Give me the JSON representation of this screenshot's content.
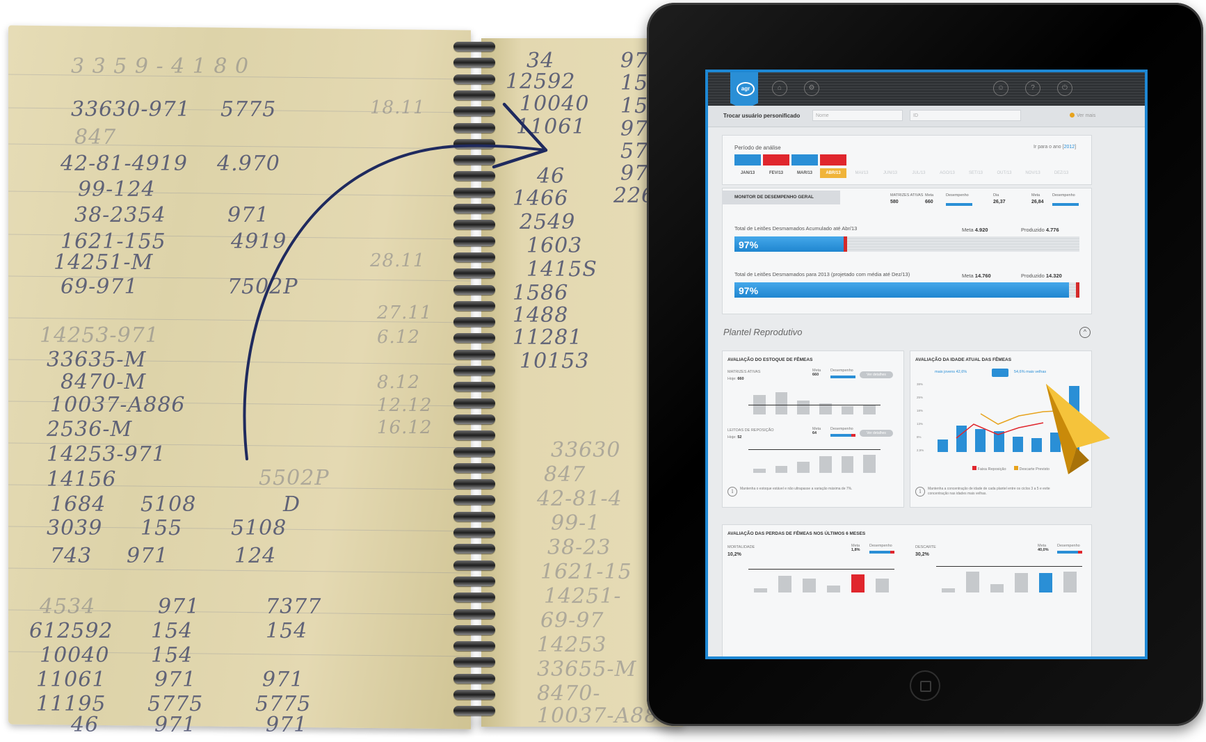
{
  "notebook": {
    "left_lines": [
      "33630-971",
      "5775",
      "42-81-4919",
      "4.970",
      "99-124",
      "38-2354",
      "971",
      "1621-155",
      "4919",
      "14251-M",
      "69-971",
      "7502P",
      "14253-971",
      "33635-M",
      "8470-M",
      "10037-A886",
      "2536-M",
      "14253-971",
      "14156",
      "1684",
      "5108",
      "155",
      "D",
      "3039",
      "155",
      "5108",
      "743",
      "971",
      "124",
      "4534",
      "971",
      "7377",
      "612592",
      "154",
      "154",
      "10040",
      "154",
      "11061",
      "971",
      "971",
      "11195",
      "5775",
      "5775",
      "46",
      "971",
      "971",
      "5502P",
      "28.11",
      "27.11",
      "6.12",
      "8.12",
      "12.12",
      "16.12"
    ],
    "right_lines": [
      "34",
      "12592",
      "10040",
      "11061",
      "46",
      "1466",
      "2549",
      "1603",
      "1415S",
      "1586",
      "1488",
      "11281",
      "10153",
      "971",
      "154",
      "154",
      "971",
      "572",
      "971",
      "226",
      "33630",
      "847",
      "42-81-4",
      "99-1",
      "38-23",
      "1621-15",
      "14251-",
      "69-97",
      "14253",
      "33655-M",
      "8470-",
      "10037-A886"
    ]
  },
  "app": {
    "logo_text": "agr",
    "user_bar": {
      "label": "Trocar usuário personificado",
      "field1_placeholder": "Nome",
      "field2_placeholder": "ID",
      "badge": "Ver mais"
    },
    "period": {
      "title": "Período de análise",
      "year_label": "Ir para o ano",
      "year": "2012",
      "months": [
        "JAN/13",
        "FEV/13",
        "MAR/13",
        "ABR/13",
        "MAI/13",
        "JUN/13",
        "JUL/13",
        "AGO/13",
        "SET/13",
        "OUT/13",
        "NOV/13",
        "DEZ/13"
      ],
      "selected": "ABR/13",
      "bar_colors": [
        "#2a8fd6",
        "#e0262d",
        "#2a8fd6",
        "#e0262d"
      ]
    },
    "monitor": {
      "tab_label": "MONITOR DE DESEMPENHO GERAL",
      "kpi1": {
        "label": "MATRIZES ATIVAS",
        "value": "580",
        "meta_label": "Meta",
        "meta": "660",
        "des_label": "Desempenho"
      },
      "kpi2": {
        "label": "Dia",
        "value": "26,37",
        "meta_label": "Meta",
        "meta": "26,84",
        "des_label": "Desempenho"
      }
    },
    "progress1": {
      "label": "Total de Leitões Desmamados Acumulado até Abr/13",
      "meta_label": "Meta",
      "meta": "4.920",
      "prod_label": "Produzido",
      "prod": "4.776",
      "percent_text": "97%",
      "percent": 0.97
    },
    "progress2": {
      "label": "Total de Leitões Desmamados para 2013 (projetado com média até Dez/13)",
      "meta_label": "Meta",
      "meta": "14.760",
      "prod_label": "Produzido",
      "prod": "14.320",
      "percent_text": "97%",
      "percent": 0.97
    },
    "plantel": {
      "title": "Plantel Reprodutivo",
      "card1": {
        "title": "AVALIAÇÃO DO ESTOQUE DE FÊMEAS",
        "sub1": "MATRIZES ATIVAS",
        "sub1_val": "660",
        "sub1_meta": "Meta",
        "sub1_meta_val": "660",
        "sub1_des": "Desempenho",
        "sub2": "LEITOAS DE REPOSIÇÃO",
        "sub2_val": "52",
        "sub2_meta": "Meta",
        "sub2_meta_val": "64",
        "sub2_des": "Desempenho",
        "pill": "Ver detalhes",
        "footnote": "Mantenha o estoque estável e não ultrapasse a variação máxima de 7%."
      },
      "card2": {
        "title": "AVALIAÇÃO DA IDADE ATUAL DAS FÊMEAS",
        "left_legend": "mais jovens 42,6%",
        "right_legend": "54,6% mais velhas",
        "y_ticks": [
          "38%",
          "25%",
          "18%",
          "13%",
          "8%",
          "2,5%"
        ],
        "legend_a": "Faixa Reposição",
        "legend_b": "Descarte Previsto",
        "footnote": "Mantenha a concentração de idade de cada plantel entre os ciclos 3 a 5 e evite concentração nas idades mais velhas."
      },
      "card3": {
        "title": "AVALIAÇÃO DAS PERDAS DE FÊMEAS NOS ÚLTIMOS 6 MESES",
        "left_label": "MORTALIDADE",
        "left_val": "10,2%",
        "left_meta": "Meta",
        "left_meta_val": "1,8%",
        "left_des": "Desempenho",
        "right_label": "DESCARTE",
        "right_val": "30,2%",
        "right_meta": "Meta",
        "right_meta_val": "40,0%",
        "right_des": "Desempenho"
      }
    }
  }
}
